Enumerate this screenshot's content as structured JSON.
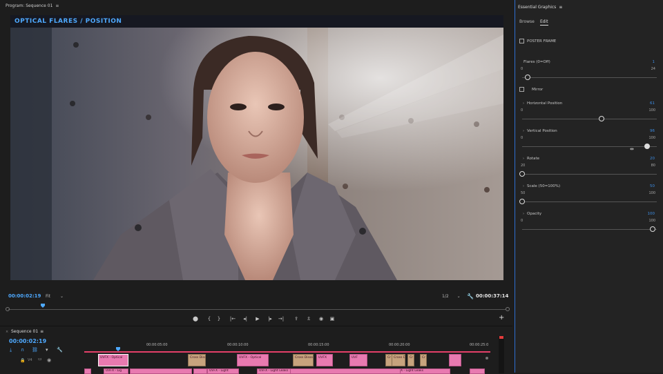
{
  "program": {
    "title": "Program: Sequence 01",
    "menu_icon": "≡",
    "heading": "OPTICAL FLARES / POSITION",
    "timecode_current": "00:00:02:19",
    "fit": "Fit",
    "resolution": "1/2",
    "timecode_duration": "00:00:37:14",
    "transport": [
      "marker-icon",
      "in-point-icon",
      "out-point-icon",
      "go-to-in-icon",
      "step-back-icon",
      "play-icon",
      "step-forward-icon",
      "go-to-out-icon",
      "lift-icon",
      "extract-icon",
      "export-frame-icon",
      "comparison-view-icon"
    ],
    "transport_glyphs": [
      "⬤",
      "{",
      "}",
      "|←",
      "◂|",
      "▶",
      "|▸",
      "→|",
      "⇪",
      "⇫",
      "◉",
      "▣"
    ]
  },
  "essential_graphics": {
    "title": "Essential Graphics",
    "menu_icon": "≡",
    "tabs": {
      "browse": "Browse",
      "edit": "Edit"
    },
    "poster_frame": {
      "label": "POSTER FRAME",
      "checked": false
    },
    "flares": {
      "label": "Flares (0=Off)",
      "value": "1",
      "min": "0",
      "max": "24",
      "level": 0.04
    },
    "mirror": {
      "label": "Mirror",
      "checked": false
    },
    "horizontal": {
      "label": "Horizontal Position",
      "value": "61",
      "min": "0",
      "max": "100",
      "level": 0.61
    },
    "vertical": {
      "label": "Vertical Position",
      "value": "96",
      "min": "0",
      "max": "100",
      "level": 0.96
    },
    "rotate": {
      "label": "Rotate",
      "value": "20",
      "min": "20",
      "max": "80",
      "level": 0.0
    },
    "scale": {
      "label": "Scale (50=100%)",
      "value": "50",
      "min": "50",
      "max": "100",
      "level": 0.0
    },
    "opacity": {
      "label": "Opacity",
      "value": "100",
      "min": "0",
      "max": "100",
      "level": 1.0
    }
  },
  "timeline": {
    "sequence_tab": "Sequence 01",
    "close": "×",
    "menu_icon": "≡",
    "timecode": "00:00:02:19",
    "ruler_ticks": [
      "00:00:05:00",
      "00:00:10:00",
      "00:00:15:00",
      "00:00:20:00",
      "00:00:25:0"
    ],
    "track_v4": "V4",
    "clips_v4": [
      {
        "label": "UVFX - Optical",
        "selected": true
      },
      {
        "label": "Cross Diss",
        "transition": true
      },
      {
        "label": "UVFX - Optical",
        "selected": false
      },
      {
        "label": "Cross Dissolve",
        "transition": true
      },
      {
        "label": "UVFX",
        "selected": false
      },
      {
        "label": "UVF",
        "selected": false
      },
      {
        "label": "Cr",
        "transition": true
      },
      {
        "label": "Cross Dis",
        "transition": true
      },
      {
        "label": "Cr",
        "transition": true
      },
      {
        "label": "Cr",
        "transition": true
      },
      {
        "label": "",
        "selected": false
      }
    ],
    "clips_v3": [
      "UVFX - Lig",
      "UVFX - Light",
      "UVFX - Light Leaks",
      "UVFX - Light Leaks"
    ]
  },
  "colors": {
    "accent": "#4ea9ff",
    "clip": "#e87ab0",
    "panel_border": "#2e6fd1"
  }
}
